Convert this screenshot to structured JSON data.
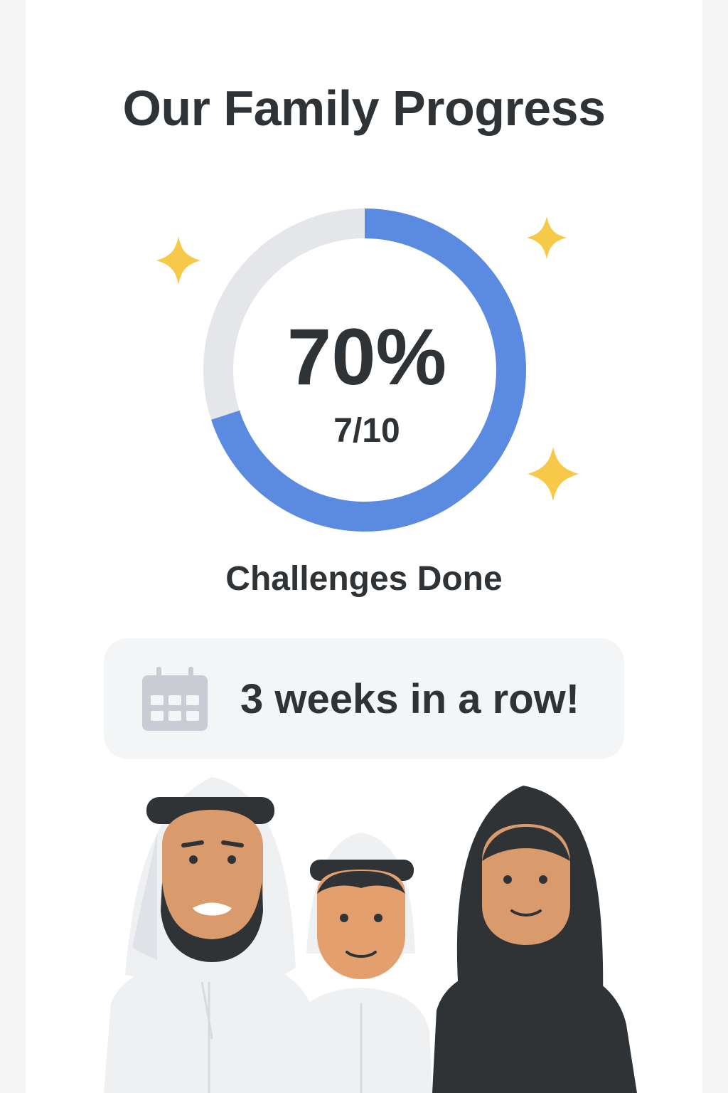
{
  "header": {
    "title": "Our Family Progress"
  },
  "progress": {
    "percent_label": "70%",
    "fraction_label": "7/10",
    "completed": 7,
    "total": 10,
    "fraction": 0.7,
    "caption": "Challenges Done",
    "ring_color": "#5b8be0",
    "track_color": "#e4e6ea"
  },
  "streak": {
    "text": "3 weeks in a row!",
    "icon": "calendar-icon"
  },
  "decor": {
    "sparkle_color": "#f7c948",
    "icons": [
      "sparkle-icon",
      "sparkle-icon",
      "sparkle-icon"
    ]
  },
  "illustration": {
    "people": [
      "father-figure",
      "son-figure",
      "mother-figure"
    ]
  }
}
